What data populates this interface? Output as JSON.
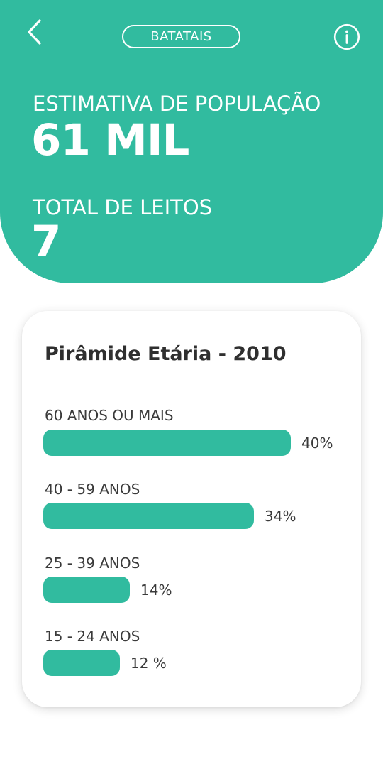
{
  "colors": {
    "accent": "#31BB9F",
    "text_dark": "#2f2f2f",
    "background": "#ffffff"
  },
  "header": {
    "back_icon": "chevron-left-icon",
    "city": "BATATAIS",
    "info_icon": "info-circle-icon",
    "population_label": "ESTIMATIVA DE POPULAÇÃO",
    "population_value": "61 MIL",
    "beds_label": "TOTAL DE LEITOS",
    "beds_value": "7"
  },
  "card": {
    "title": "Pirâmide Etária - 2010",
    "rows": [
      {
        "label": "60 ANOS OU MAIS",
        "value": 40,
        "value_text": "40%"
      },
      {
        "label": "40 - 59 ANOS",
        "value": 34,
        "value_text": "34%"
      },
      {
        "label": "25 - 39 ANOS",
        "value": 14,
        "value_text": "14%"
      },
      {
        "label": "15 - 24 ANOS",
        "value": 12,
        "value_text": "12 %"
      }
    ]
  }
}
